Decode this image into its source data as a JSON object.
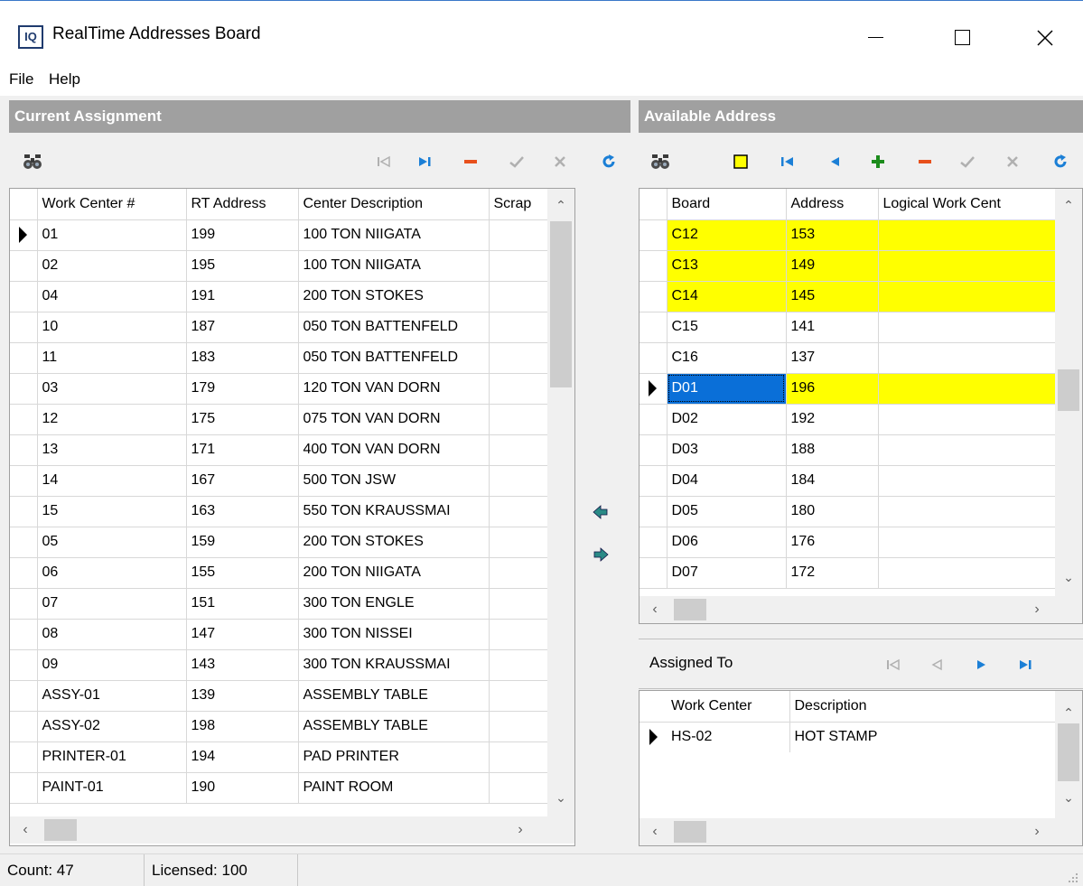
{
  "window": {
    "app_icon_text": "IQ",
    "title": "RealTime Addresses Board"
  },
  "menu": [
    "File",
    "Help"
  ],
  "left_panel": {
    "header": "Current Assignment",
    "columns": [
      "Work Center #",
      "RT Address",
      "Center Description",
      "Scrap"
    ],
    "selected_row": 0,
    "rows": [
      [
        "01",
        "199",
        "100 TON NIIGATA",
        ""
      ],
      [
        "02",
        "195",
        "100 TON NIIGATA",
        ""
      ],
      [
        "04",
        "191",
        "200 TON STOKES",
        ""
      ],
      [
        "10",
        "187",
        "050 TON BATTENFELD",
        ""
      ],
      [
        "11",
        "183",
        "050 TON BATTENFELD",
        ""
      ],
      [
        "03",
        "179",
        "120 TON VAN DORN",
        ""
      ],
      [
        "12",
        "175",
        "075 TON VAN DORN",
        ""
      ],
      [
        "13",
        "171",
        "400 TON VAN DORN",
        ""
      ],
      [
        "14",
        "167",
        "500 TON JSW",
        ""
      ],
      [
        "15",
        "163",
        "550 TON KRAUSSMAI",
        ""
      ],
      [
        "05",
        "159",
        "200 TON STOKES",
        ""
      ],
      [
        "06",
        "155",
        "200 TON NIIGATA",
        ""
      ],
      [
        "07",
        "151",
        "300 TON ENGLE",
        ""
      ],
      [
        "08",
        "147",
        "300 TON NISSEI",
        ""
      ],
      [
        "09",
        "143",
        "300 TON KRAUSSMAI",
        ""
      ],
      [
        "ASSY-01",
        "139",
        "ASSEMBLY TABLE",
        ""
      ],
      [
        "ASSY-02",
        "198",
        "ASSEMBLY TABLE",
        ""
      ],
      [
        "PRINTER-01",
        "194",
        "PAD PRINTER",
        ""
      ],
      [
        "PAINT-01",
        "190",
        "PAINT ROOM",
        ""
      ]
    ]
  },
  "right_panel": {
    "header": "Available Address",
    "columns": [
      "Board",
      "Address",
      "Logical Work Cent"
    ],
    "rows": [
      {
        "cells": [
          "C12",
          "153",
          ""
        ],
        "highlight": true
      },
      {
        "cells": [
          "C13",
          "149",
          ""
        ],
        "highlight": true
      },
      {
        "cells": [
          "C14",
          "145",
          ""
        ],
        "highlight": true
      },
      {
        "cells": [
          "C15",
          "141",
          ""
        ],
        "highlight": false
      },
      {
        "cells": [
          "C16",
          "137",
          ""
        ],
        "highlight": false
      },
      {
        "cells": [
          "D01",
          "196",
          ""
        ],
        "highlight": true,
        "selected": true
      },
      {
        "cells": [
          "D02",
          "192",
          ""
        ],
        "highlight": false
      },
      {
        "cells": [
          "D03",
          "188",
          ""
        ],
        "highlight": false
      },
      {
        "cells": [
          "D04",
          "184",
          ""
        ],
        "highlight": false
      },
      {
        "cells": [
          "D05",
          "180",
          ""
        ],
        "highlight": false
      },
      {
        "cells": [
          "D06",
          "176",
          ""
        ],
        "highlight": false
      },
      {
        "cells": [
          "D07",
          "172",
          ""
        ],
        "highlight": false
      }
    ],
    "highlight_color": "#ffff00",
    "selection_color": "#0a6fd8"
  },
  "assigned_panel": {
    "header": "Assigned To",
    "columns": [
      "Work Center",
      "Description"
    ],
    "rows": [
      [
        "HS-02",
        "HOT STAMP"
      ]
    ]
  },
  "status": {
    "count": "Count: 47",
    "licensed": "Licensed: 100"
  },
  "colors": {
    "panel_header": "#a0a0a0",
    "icon_blue": "#1b7fd6",
    "icon_red": "#e8501c",
    "icon_green": "#1c8c1c",
    "icon_teal": "#2a8a86"
  }
}
